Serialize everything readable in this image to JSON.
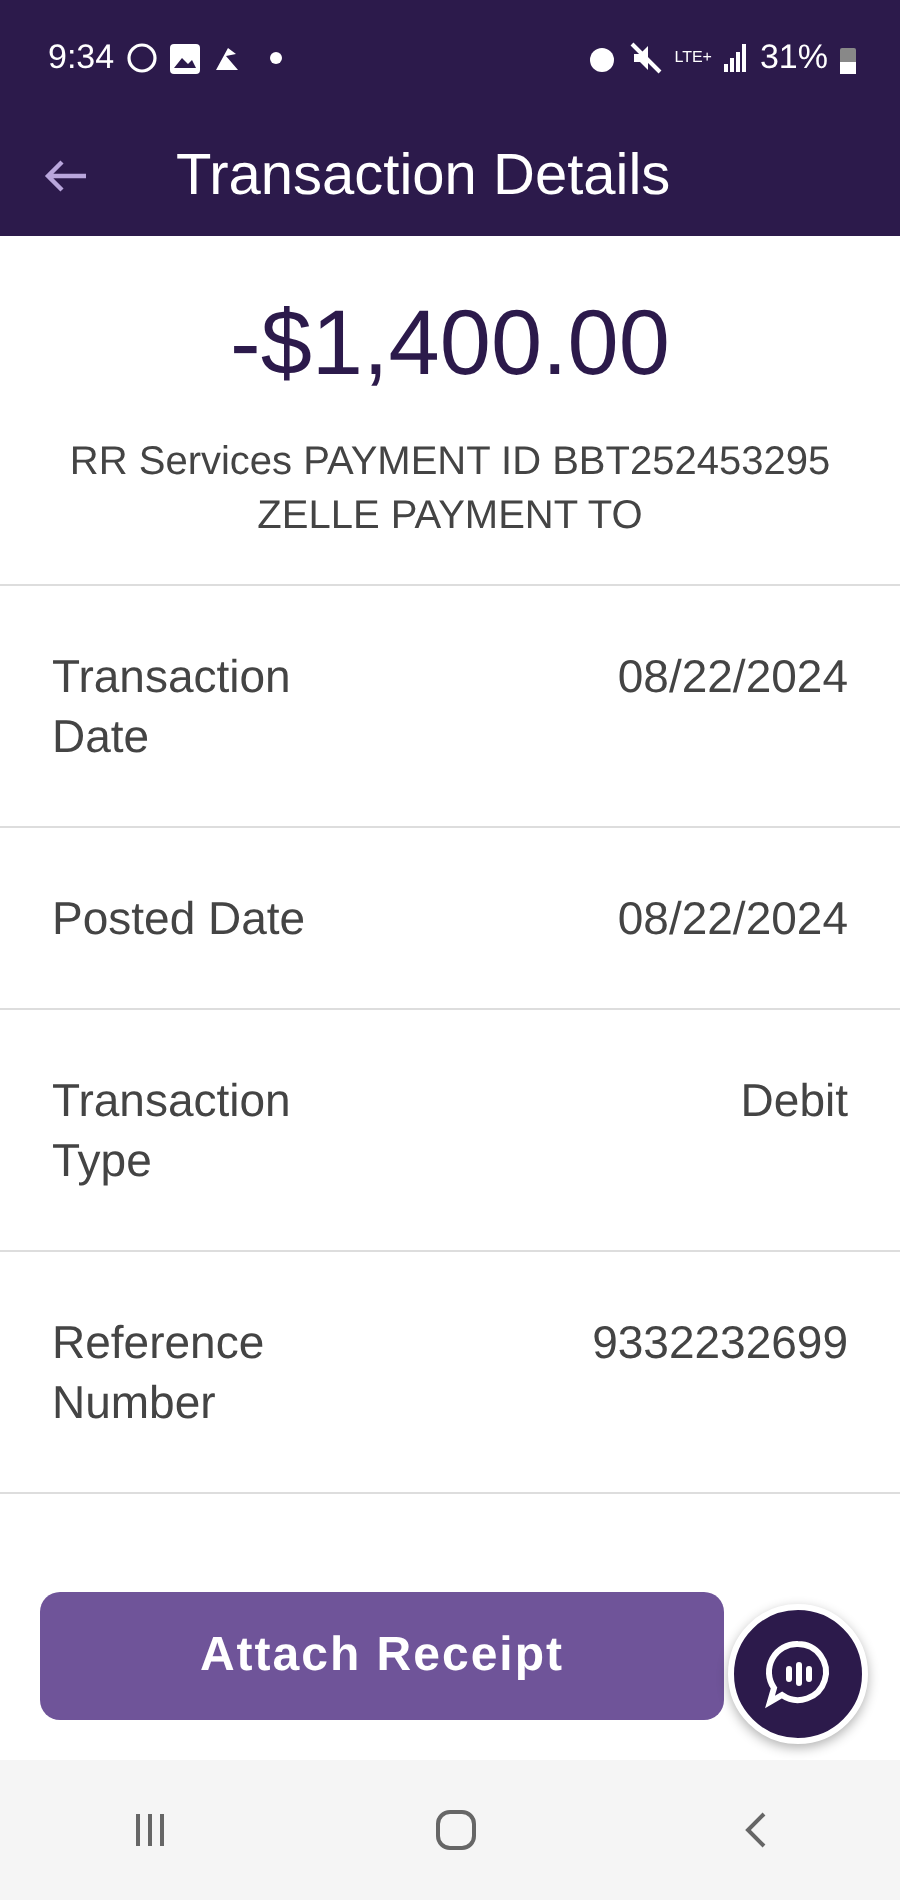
{
  "status_bar": {
    "time": "9:34",
    "network": "LTE+",
    "battery": "31%"
  },
  "header": {
    "title": "Transaction Details"
  },
  "amount": "-$1,400.00",
  "description": "RR Services PAYMENT ID BBT252453295 ZELLE PAYMENT TO",
  "details": [
    {
      "label": "Transaction Date",
      "value": "08/22/2024"
    },
    {
      "label": "Posted Date",
      "value": "08/22/2024"
    },
    {
      "label": "Transaction Type",
      "value": "Debit"
    },
    {
      "label": "Reference Number",
      "value": "9332232699"
    }
  ],
  "button": "Attach Receipt"
}
